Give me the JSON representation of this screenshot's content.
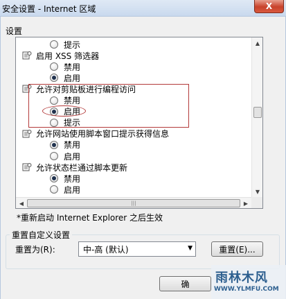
{
  "window": {
    "title": "安全设置 - Internet 区域",
    "close_label": "X"
  },
  "settings_label": "设置",
  "tree": [
    {
      "kind": "radio",
      "label": "提示",
      "checked": false
    },
    {
      "kind": "group",
      "label": "启用 XSS 筛选器"
    },
    {
      "kind": "radio",
      "label": "禁用",
      "checked": false
    },
    {
      "kind": "radio",
      "label": "启用",
      "checked": true
    },
    {
      "kind": "group",
      "label": "允许对剪贴板进行编程访问"
    },
    {
      "kind": "radio",
      "label": "禁用",
      "checked": false
    },
    {
      "kind": "radio",
      "label": "启用",
      "checked": true
    },
    {
      "kind": "radio",
      "label": "提示",
      "checked": false
    },
    {
      "kind": "group",
      "label": "允许网站使用脚本窗口提示获得信息"
    },
    {
      "kind": "radio",
      "label": "禁用",
      "checked": true
    },
    {
      "kind": "radio",
      "label": "启用",
      "checked": false
    },
    {
      "kind": "group",
      "label": "允许状态栏通过脚本更新"
    },
    {
      "kind": "radio",
      "label": "禁用",
      "checked": true
    },
    {
      "kind": "radio",
      "label": "启用",
      "checked": false
    }
  ],
  "note": "*重新启动 Internet Explorer 之后生效",
  "reset_group": {
    "title": "重置自定义设置",
    "reset_to_label": "重置为(R):",
    "selected": "中-高 (默认)",
    "reset_button": "重置(E)..."
  },
  "footer": {
    "ok_label": "确"
  },
  "watermark": {
    "text": "雨林木风",
    "url": "WWW.YLMFU.COM"
  },
  "colors": {
    "highlight": "#b33a3a",
    "accent": "#2d5f8f"
  }
}
